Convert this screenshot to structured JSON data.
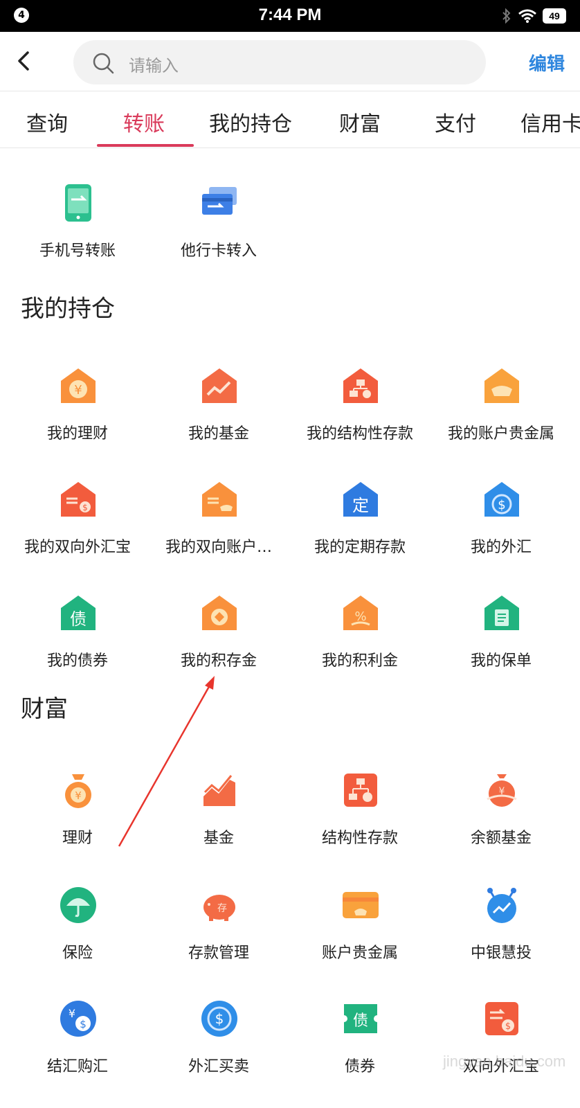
{
  "status_bar": {
    "notification_count": "4",
    "time": "7:44 PM",
    "battery": "49"
  },
  "search": {
    "placeholder": "请输入"
  },
  "header": {
    "edit_label": "编辑"
  },
  "tabs": [
    {
      "label": "查询"
    },
    {
      "label": "转账",
      "active": true
    },
    {
      "label": "我的持仓"
    },
    {
      "label": "财富"
    },
    {
      "label": "支付"
    },
    {
      "label": "信用卡"
    }
  ],
  "transfer": {
    "items": [
      {
        "label": "手机号转账",
        "icon": "phone-transfer-icon"
      },
      {
        "label": "他行卡转入",
        "icon": "card-transfer-icon"
      }
    ]
  },
  "holdings": {
    "title": "我的持仓",
    "items": [
      {
        "label": "我的理财",
        "icon": "house-yen-icon"
      },
      {
        "label": "我的基金",
        "icon": "house-chart-icon"
      },
      {
        "label": "我的结构性存款",
        "icon": "house-structure-icon"
      },
      {
        "label": "我的账户贵金属",
        "icon": "house-gold-icon"
      },
      {
        "label": "我的双向外汇宝",
        "icon": "house-forex-icon"
      },
      {
        "label": "我的双向账户…",
        "icon": "house-exchange-icon"
      },
      {
        "label": "我的定期存款",
        "icon": "house-fixed-deposit-icon"
      },
      {
        "label": "我的外汇",
        "icon": "house-dollar-icon"
      },
      {
        "label": "我的债券",
        "icon": "house-bond-icon"
      },
      {
        "label": "我的积存金",
        "icon": "house-coin-icon"
      },
      {
        "label": "我的积利金",
        "icon": "house-percent-icon"
      },
      {
        "label": "我的保单",
        "icon": "house-policy-icon"
      }
    ]
  },
  "wealth": {
    "title": "财富",
    "items": [
      {
        "label": "理财",
        "icon": "money-bag-icon"
      },
      {
        "label": "基金",
        "icon": "fund-chart-icon"
      },
      {
        "label": "结构性存款",
        "icon": "structured-deposit-icon"
      },
      {
        "label": "余额基金",
        "icon": "balance-fund-icon"
      },
      {
        "label": "保险",
        "icon": "umbrella-icon"
      },
      {
        "label": "存款管理",
        "icon": "piggy-bank-icon"
      },
      {
        "label": "账户贵金属",
        "icon": "precious-metal-card-icon"
      },
      {
        "label": "中银慧投",
        "icon": "robot-advisor-icon"
      },
      {
        "label": "结汇购汇",
        "icon": "currency-exchange-icon"
      },
      {
        "label": "外汇买卖",
        "icon": "forex-trade-icon"
      },
      {
        "label": "债券",
        "icon": "bond-ticket-icon"
      },
      {
        "label": "双向外汇宝",
        "icon": "two-way-forex-icon"
      }
    ]
  },
  "colors": {
    "accent": "#d93a5a",
    "link": "#2e86de",
    "orange": "#f7873a",
    "blue": "#2f7be0",
    "green": "#21b37f"
  },
  "watermark": "jingyan.baidu.com"
}
